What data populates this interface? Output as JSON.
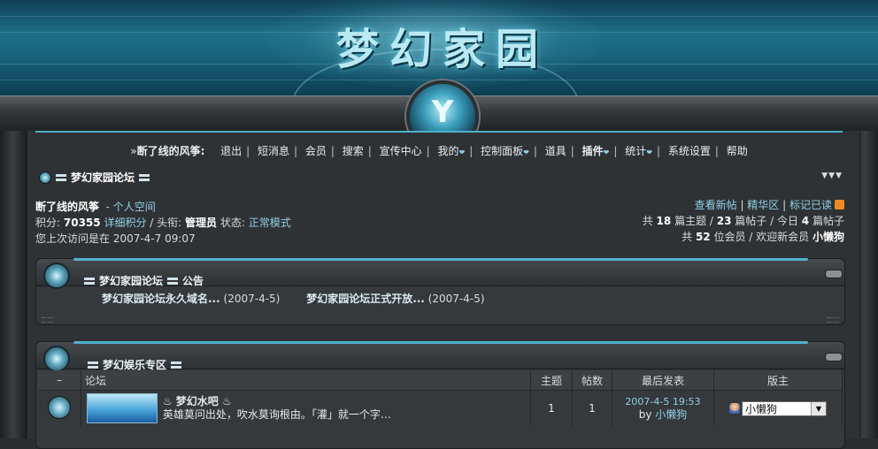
{
  "banner": {
    "title": "梦幻家园"
  },
  "nav": {
    "prefix": "»",
    "username": "断了线的风筝:",
    "items": [
      {
        "label": "退出"
      },
      {
        "label": "短消息"
      },
      {
        "label": "会员"
      },
      {
        "label": "搜索"
      },
      {
        "label": "宣传中心"
      },
      {
        "label": "我的",
        "dropdown": true
      },
      {
        "label": "控制面板",
        "dropdown": true
      },
      {
        "label": "道具"
      },
      {
        "label": "插件",
        "dropdown": true
      },
      {
        "label": "统计",
        "dropdown": true
      },
      {
        "label": "系统设置"
      },
      {
        "label": "帮助"
      }
    ]
  },
  "breadcrumb": {
    "label": "梦幻家园论坛"
  },
  "user": {
    "name": "断了线的风筝",
    "space_link": "- 个人空间",
    "points_label": "积分:",
    "points": "70355",
    "points_detail": "详细积分",
    "title_label": "/ 头衔:",
    "title": "管理员",
    "status_label": "状态:",
    "status": "正常模式",
    "last_visit": "您上次访问是在 2007-4-7 09:07"
  },
  "stats": {
    "links": [
      "查看新帖",
      "精华区",
      "标记已读"
    ],
    "line1": {
      "pre": "共",
      "topics": "18",
      "t_mid": "篇主题 /",
      "posts": "23",
      "p_mid": "篇帖子 / 今日",
      "today": "4",
      "tail": "篇帖子"
    },
    "line2": {
      "pre": "共",
      "members": "52",
      "mid": "位会员 / 欢迎新会员",
      "newest": "小懒狗"
    }
  },
  "announcements": {
    "title_prefix": "梦幻家园论坛",
    "title": "公告",
    "items": [
      {
        "text": "梦幻家园论坛永久域名...",
        "date": "(2007-4-5)"
      },
      {
        "text": "梦幻家园论坛正式开放...",
        "date": "(2007-4-5)"
      }
    ]
  },
  "section": {
    "title": "梦幻娱乐专区",
    "columns": {
      "collapse": "–",
      "forum": "论坛",
      "topics": "主题",
      "posts": "帖数",
      "last": "最后发表",
      "mods": "版主"
    },
    "forums": [
      {
        "name": "梦幻水吧",
        "deco": "♨",
        "description": "英雄莫问出处，吹水莫询根由。「灌」就一个字…",
        "topics": "1",
        "posts": "1",
        "last_time": "2007-4-5 19:53",
        "last_by_prefix": "by",
        "last_by": "小懒狗",
        "moderator": "小懒狗"
      }
    ]
  }
}
